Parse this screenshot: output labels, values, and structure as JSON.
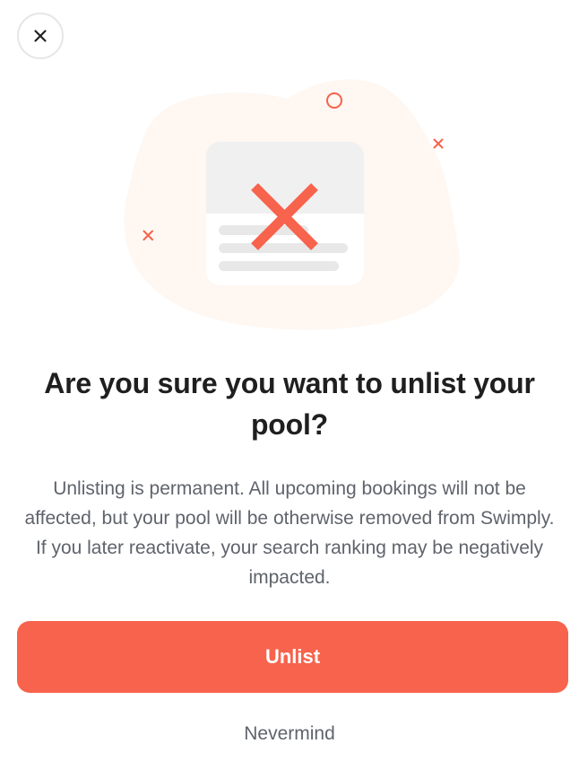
{
  "header": {
    "close_icon": "close-icon"
  },
  "illustration": {
    "icon": "unlisted-card-illustration",
    "accent_color": "#f7634c",
    "blob_color": "#fef7f2"
  },
  "dialog": {
    "title": "Are you sure you want to unlist your pool?",
    "message": "Unlisting is permanent. All upcoming bookings will not be affected, but your pool will be otherwise removed from Swimply. If you later reactivate, your search ranking may be negatively impacted.",
    "confirm_label": "Unlist",
    "cancel_label": "Nevermind"
  },
  "colors": {
    "primary": "#f7634c",
    "title_text": "#1f1f1f",
    "body_text": "#5f636b"
  }
}
